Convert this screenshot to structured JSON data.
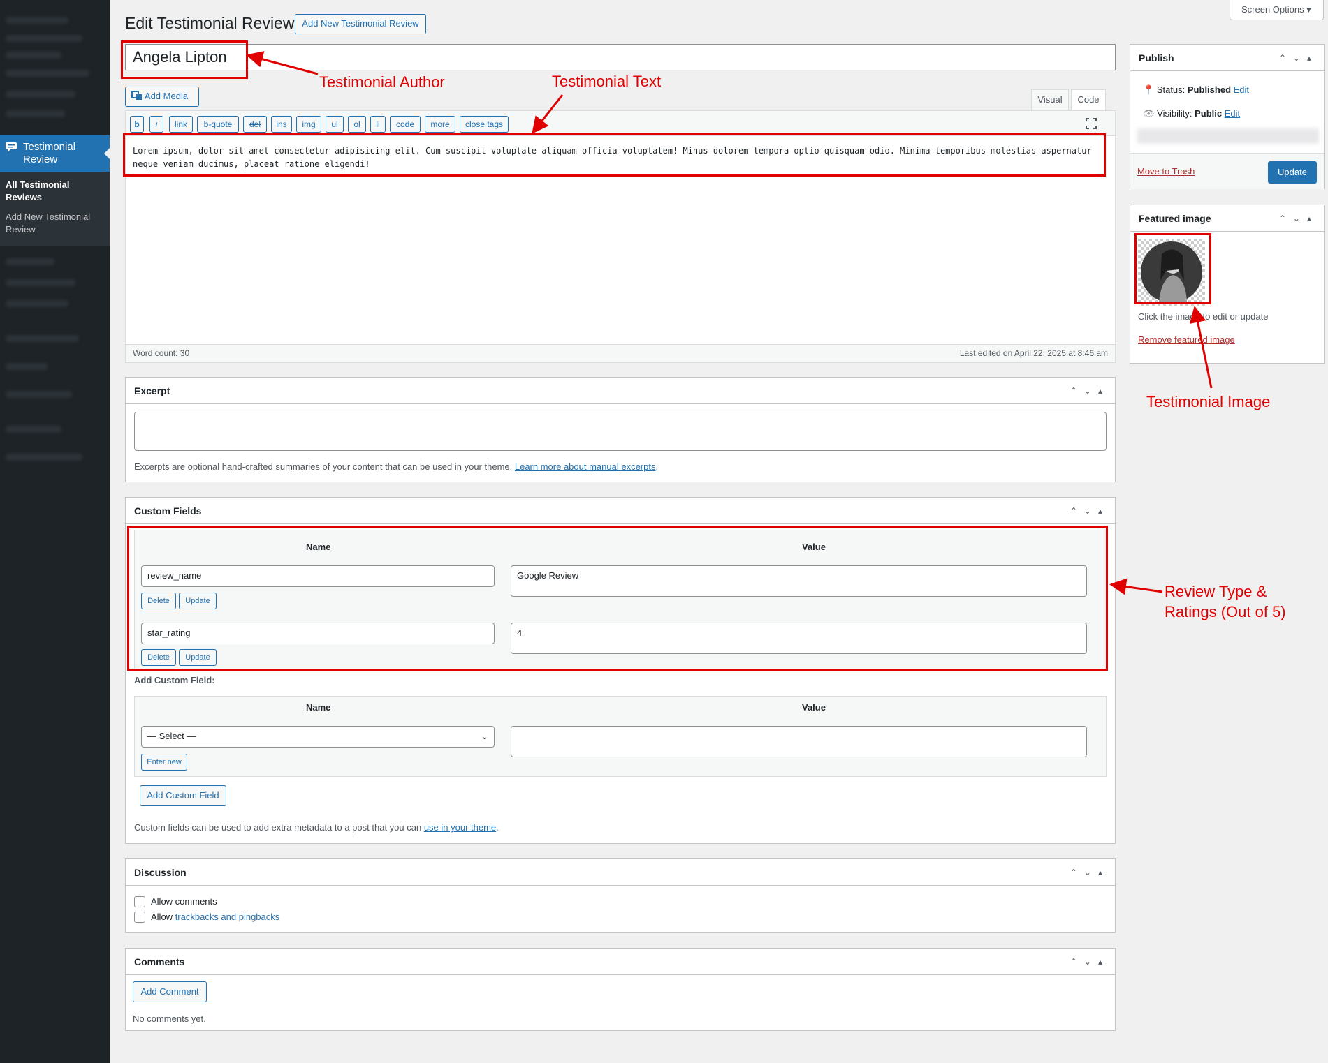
{
  "header": {
    "title": "Edit Testimonial Review",
    "add_new": "Add New Testimonial Review",
    "screen_options": "Screen Options ▾"
  },
  "sidebar": {
    "current_menu": "Testimonial Review",
    "submenu_current": "All Testimonial Reviews",
    "submenu_other": "Add New Testimonial Review"
  },
  "post": {
    "title": "Angela Lipton",
    "content": "Lorem ipsum, dolor sit amet consectetur adipisicing elit. Cum suscipit voluptate aliquam officia voluptatem! Minus dolorem tempora optio quisquam odio. Minima temporibus molestias aspernatur neque veniam ducimus, placeat ratione eligendi!",
    "word_count": "Word count: 30",
    "last_edited": "Last edited on April 22, 2025 at 8:46 am"
  },
  "editor": {
    "add_media": "Add Media",
    "tab_visual": "Visual",
    "tab_code": "Code",
    "quicktags": [
      "b",
      "i",
      "link",
      "b-quote",
      "del",
      "ins",
      "img",
      "ul",
      "ol",
      "li",
      "code",
      "more",
      "close tags"
    ]
  },
  "publish": {
    "title": "Publish",
    "status_label": "Status: ",
    "status_value": "Published",
    "status_edit": "Edit",
    "visibility_label": "Visibility: ",
    "visibility_value": "Public",
    "visibility_edit": "Edit",
    "trash": "Move to Trash",
    "update": "Update"
  },
  "featured": {
    "title": "Featured image",
    "hint": "Click the image to edit or update",
    "remove": "Remove featured image"
  },
  "excerpt": {
    "title": "Excerpt",
    "desc": "Excerpts are optional hand-crafted summaries of your content that can be used in your theme. ",
    "link": "Learn more about manual excerpts",
    "tail": "."
  },
  "custom_fields": {
    "title": "Custom Fields",
    "col_name": "Name",
    "col_value": "Value",
    "rows": [
      {
        "name": "review_name",
        "value": "Google Review"
      },
      {
        "name": "star_rating",
        "value": "4"
      }
    ],
    "delete": "Delete",
    "update": "Update",
    "add_label": "Add Custom Field:",
    "select": "— Select —",
    "enter_new": "Enter new",
    "add_button": "Add Custom Field",
    "footer": "Custom fields can be used to add extra metadata to a post that you can ",
    "footer_link": "use in your theme",
    "footer_tail": "."
  },
  "discussion": {
    "title": "Discussion",
    "allow_comments": "Allow comments",
    "allow_prefix": "Allow ",
    "trackbacks": "trackbacks and pingbacks"
  },
  "comments": {
    "title": "Comments",
    "add": "Add Comment",
    "none": "No comments yet."
  },
  "annotations": {
    "author": "Testimonial Author",
    "text": "Testimonial Text",
    "image": "Testimonial Image",
    "review_line1": "Review Type &",
    "review_line2": "Ratings (Out of 5)"
  },
  "colors": {
    "accent": "#2271b1",
    "annotation": "#e00000",
    "sidebar": "#1d2327"
  }
}
